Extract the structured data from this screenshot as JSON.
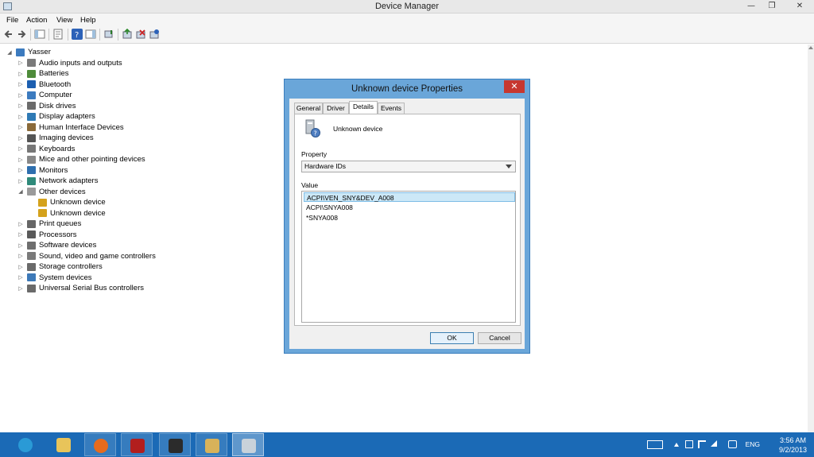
{
  "window": {
    "title": "Device Manager",
    "min_glyph": "—",
    "max_glyph": "❐",
    "close_glyph": "✕"
  },
  "menu": [
    "File",
    "Action",
    "View",
    "Help"
  ],
  "tree": {
    "root": "Yasser",
    "items": [
      {
        "label": "Audio inputs and outputs",
        "icon": "speaker-icon",
        "color": "#7a7a7a",
        "expanded": false
      },
      {
        "label": "Batteries",
        "icon": "battery-icon",
        "color": "#4e8b3a",
        "expanded": false
      },
      {
        "label": "Bluetooth",
        "icon": "bluetooth-icon",
        "color": "#1c5fb0",
        "expanded": false
      },
      {
        "label": "Computer",
        "icon": "computer-icon",
        "color": "#3c7bbf",
        "expanded": false
      },
      {
        "label": "Disk drives",
        "icon": "disk-icon",
        "color": "#6b6b6b",
        "expanded": false
      },
      {
        "label": "Display adapters",
        "icon": "display-icon",
        "color": "#2f7ab5",
        "expanded": false
      },
      {
        "label": "Human Interface Devices",
        "icon": "hid-icon",
        "color": "#8a6a3a",
        "expanded": false
      },
      {
        "label": "Imaging devices",
        "icon": "camera-icon",
        "color": "#555555",
        "expanded": false
      },
      {
        "label": "Keyboards",
        "icon": "keyboard-icon",
        "color": "#777777",
        "expanded": false
      },
      {
        "label": "Mice and other pointing devices",
        "icon": "mouse-icon",
        "color": "#888888",
        "expanded": false
      },
      {
        "label": "Monitors",
        "icon": "monitor-icon",
        "color": "#2e6fae",
        "expanded": false
      },
      {
        "label": "Network adapters",
        "icon": "network-icon",
        "color": "#2f8a7a",
        "expanded": false
      },
      {
        "label": "Other devices",
        "icon": "other-devices-icon",
        "color": "#9a9a9a",
        "expanded": true,
        "children": [
          {
            "label": "Unknown device",
            "icon": "warning-device-icon",
            "color": "#d4a21c"
          },
          {
            "label": "Unknown device",
            "icon": "warning-device-icon",
            "color": "#d4a21c"
          }
        ]
      },
      {
        "label": "Print queues",
        "icon": "printer-icon",
        "color": "#666666",
        "expanded": false
      },
      {
        "label": "Processors",
        "icon": "processor-icon",
        "color": "#5a5a5a",
        "expanded": false
      },
      {
        "label": "Software devices",
        "icon": "software-device-icon",
        "color": "#6e6e6e",
        "expanded": false
      },
      {
        "label": "Sound, video and game controllers",
        "icon": "sound-icon",
        "color": "#7a7a7a",
        "expanded": false
      },
      {
        "label": "Storage controllers",
        "icon": "storage-icon",
        "color": "#6a6a6a",
        "expanded": false
      },
      {
        "label": "System devices",
        "icon": "system-icon",
        "color": "#3d79b8",
        "expanded": false
      },
      {
        "label": "Universal Serial Bus controllers",
        "icon": "usb-icon",
        "color": "#6a6a6a",
        "expanded": false
      }
    ]
  },
  "dialog": {
    "title": "Unknown device Properties",
    "close_glyph": "✕",
    "tabs": [
      "General",
      "Driver",
      "Details",
      "Events"
    ],
    "active_tab": "Details",
    "device_name": "Unknown device",
    "property_label": "Property",
    "property_value": "Hardware IDs",
    "value_label": "Value",
    "values": [
      "ACPI\\VEN_SNY&DEV_A008",
      "ACPI\\SNYA008",
      "*SNYA008"
    ],
    "ok": "OK",
    "cancel": "Cancel"
  },
  "taskbar": {
    "apps": [
      {
        "name": "internet-explorer-icon",
        "color": "#2a9ad6"
      },
      {
        "name": "file-explorer-icon",
        "color": "#e8c45a"
      },
      {
        "name": "firefox-icon",
        "color": "#e66b1e"
      },
      {
        "name": "red-app-icon",
        "color": "#b21e1e"
      },
      {
        "name": "dark-app-icon",
        "color": "#2b2b2b"
      },
      {
        "name": "control-panel-icon",
        "color": "#d8b25a"
      },
      {
        "name": "device-manager-icon",
        "color": "#c9d2da"
      }
    ],
    "language": "ENG",
    "time": "3:56 AM",
    "date": "9/2/2013"
  },
  "colors": {
    "dialog_border": "#6aa6d9",
    "taskbar": "#1b6ab6",
    "selection": "#cce8f7",
    "close_red": "#c7372f"
  }
}
